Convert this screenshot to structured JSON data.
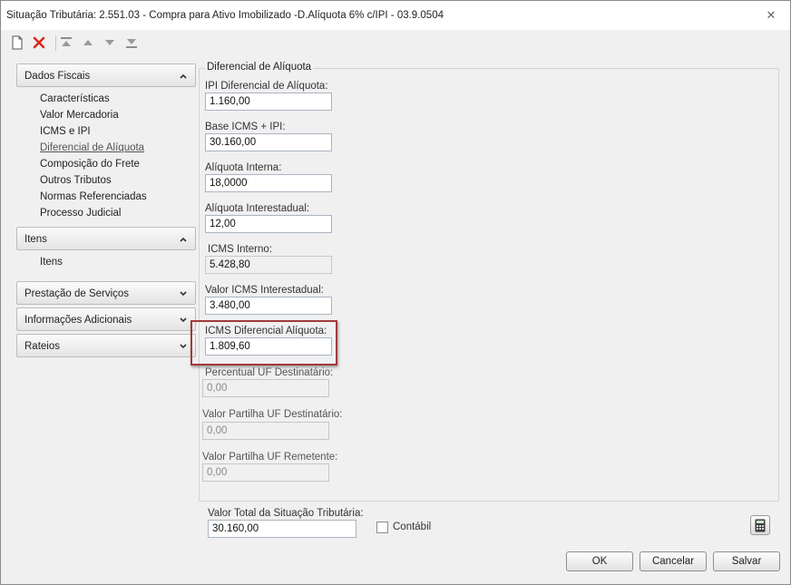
{
  "window": {
    "title": "Situação Tributária: 2.551.03 - Compra para Ativo Imobilizado -D.Alíquota 6% c/IPI - 03.9.0504"
  },
  "toolbar": {
    "icons": [
      "new-document-icon",
      "delete-icon",
      "move-first-icon",
      "move-up-icon",
      "move-down-icon",
      "move-last-icon"
    ]
  },
  "sidebar": {
    "sections": [
      {
        "label": "Dados Fiscais",
        "expanded": true,
        "items": [
          "Características",
          "Valor Mercadoria",
          "ICMS e IPI",
          "Diferencial de Alíquota",
          "Composição do Frete",
          "Outros Tributos",
          "Normas Referenciadas",
          "Processo Judicial"
        ],
        "active_item": "Diferencial de Alíquota"
      },
      {
        "label": "Itens",
        "expanded": true,
        "items": [
          "Itens"
        ]
      },
      {
        "label": "Prestação de Serviços",
        "expanded": false
      },
      {
        "label": "Informações Adicionais",
        "expanded": false
      },
      {
        "label": "Rateios",
        "expanded": false
      }
    ]
  },
  "group": {
    "title": "Diferencial de Alíquota"
  },
  "fields": [
    {
      "label": "IPI Diferencial de Alíquota:",
      "value": "1.160,00",
      "state": "editable"
    },
    {
      "label": "Base ICMS + IPI:",
      "value": "30.160,00",
      "state": "editable"
    },
    {
      "label": "Alíquota Interna:",
      "value": "18,0000",
      "state": "editable"
    },
    {
      "label": "Alíquota Interestadual:",
      "value": "12,00",
      "state": "editable"
    },
    {
      "label": "ICMS Interno:",
      "value": "5.428,80",
      "state": "readonly"
    },
    {
      "label": "Valor ICMS Interestadual:",
      "value": "3.480,00",
      "state": "editable"
    },
    {
      "label": "ICMS Diferencial Alíquota:",
      "value": "1.809,60",
      "state": "editable"
    },
    {
      "label": "Percentual UF Destinatário:",
      "value": "0,00",
      "state": "disabled"
    },
    {
      "label": "Valor Partilha UF Destinatário:",
      "value": "0,00",
      "state": "disabled"
    },
    {
      "label": "Valor Partilha UF Remetente:",
      "value": "0,00",
      "state": "disabled"
    }
  ],
  "footer": {
    "total_label": "Valor Total da Situação Tributária:",
    "total_value": "30.160,00",
    "contabil_label": "Contábil",
    "contabil_checked": false
  },
  "buttons": {
    "ok": "OK",
    "cancel": "Cancelar",
    "save": "Salvar"
  },
  "colors": {
    "highlight_border": "#a23a3a",
    "delete_icon": "#d9261c",
    "window_bg": "#f0f0f0"
  }
}
